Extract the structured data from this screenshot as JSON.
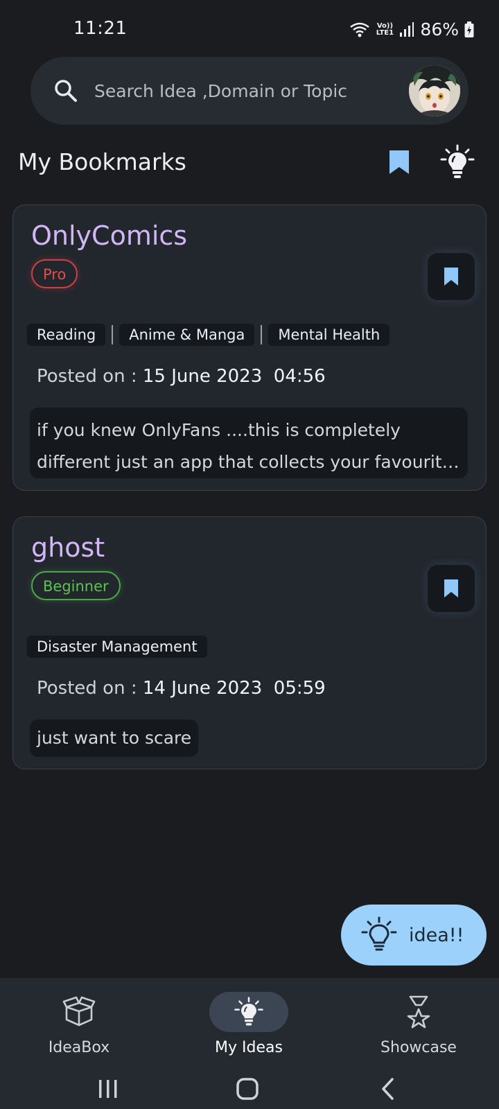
{
  "status": {
    "time": "11:21",
    "battery": "86%",
    "network": "Vo)) LTE1"
  },
  "search": {
    "placeholder": "Search Idea ,Domain or Topic"
  },
  "header": {
    "title": "My Bookmarks"
  },
  "cards": [
    {
      "title": "OnlyComics",
      "level": "Pro",
      "tags": [
        "Reading",
        "Anime & Manga",
        "Mental Health"
      ],
      "posted_label": "Posted on :",
      "posted_date": "15 June 2023  04:56",
      "description": "if you knew OnlyFans ....this is completely different  just an app that collects your favourite comics and manga in one place"
    },
    {
      "title": "ghost",
      "level": "Beginner",
      "tags": [
        "Disaster Management"
      ],
      "posted_label": "Posted on :",
      "posted_date": "14 June 2023  05:59",
      "description": "just want to scare"
    }
  ],
  "fab": {
    "label": "idea!!"
  },
  "bottom_nav": {
    "items": [
      {
        "label": "IdeaBox",
        "icon": "box-icon",
        "active": false
      },
      {
        "label": "My Ideas",
        "icon": "lightbulb-icon",
        "active": true
      },
      {
        "label": "Showcase",
        "icon": "trophy-icon",
        "active": false
      }
    ]
  },
  "colors": {
    "accent": "#9bd1fb",
    "title": "#d4b5f5",
    "pro": "#e0504c",
    "beginner": "#5fc152",
    "background": "#1b1c1f"
  }
}
